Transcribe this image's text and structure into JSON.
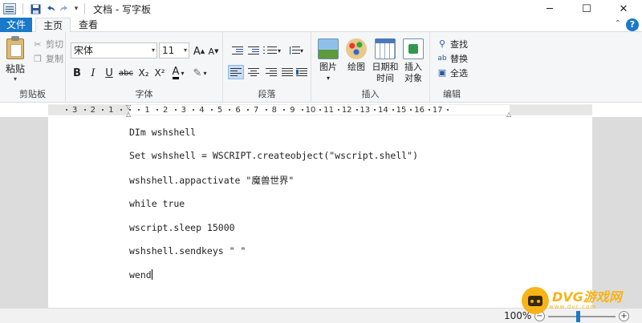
{
  "titlebar": {
    "title": "文档 - 写字板",
    "qat": {
      "save": "save-icon",
      "undo": "undo-icon",
      "redo": "redo-icon"
    },
    "window_controls": {
      "minimize": "─",
      "maximize": "☐",
      "close": "✕"
    }
  },
  "tabs": [
    {
      "label": "文件",
      "active": false
    },
    {
      "label": "主页",
      "active": true
    },
    {
      "label": "查看",
      "active": false
    }
  ],
  "ribbon": {
    "clipboard": {
      "label": "剪贴板",
      "paste": "粘贴",
      "cut": "剪切",
      "copy": "复制"
    },
    "font": {
      "label": "字体",
      "font_name": "宋体",
      "font_size": "11",
      "buttons": {
        "bold": "B",
        "italic": "I",
        "underline": "U",
        "strikethrough": "abc",
        "subscript": "X₂",
        "superscript": "X²"
      }
    },
    "paragraph": {
      "label": "段落"
    },
    "insert": {
      "label": "插入",
      "picture": "图片",
      "paint": "绘图",
      "datetime_line1": "日期和",
      "datetime_line2": "时间",
      "object_line1": "插入",
      "object_line2": "对象"
    },
    "editing": {
      "label": "编辑",
      "find": "查找",
      "replace": "替换",
      "select_all": "全选"
    }
  },
  "ruler": {
    "numbers": [
      "3",
      "2",
      "1",
      "1",
      "2",
      "3",
      "4",
      "5",
      "6",
      "7",
      "8",
      "9",
      "10",
      "11",
      "12",
      "13",
      "14",
      "15",
      "16",
      "17"
    ]
  },
  "document": {
    "lines": [
      "DIm wshshell",
      "Set wshshell = WSCRIPT.createobject(\"wscript.shell\")",
      "wshshell.appactivate \"魔兽世界\"",
      "while true",
      "wscript.sleep 15000",
      "wshshell.sendkeys \" \"",
      "wend"
    ]
  },
  "statusbar": {
    "zoom": "100%",
    "zoom_level": 1.0
  },
  "watermark": {
    "brand": "DVG游戏网",
    "sub": "www.dvc.com"
  }
}
